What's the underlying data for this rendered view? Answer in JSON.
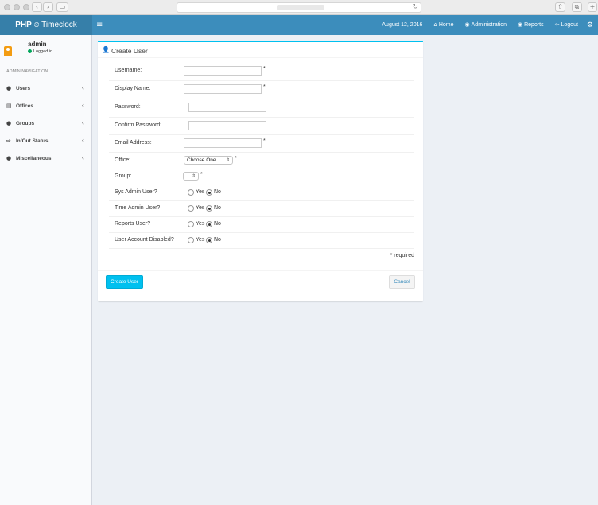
{
  "browser": {
    "back_glyph": "‹",
    "forward_glyph": "›",
    "sidebar_glyph": "▭",
    "reload_glyph": "↻",
    "share_glyph": "⇧",
    "tabs_glyph": "⧉",
    "newtab_glyph": "+"
  },
  "header": {
    "logo_bold": "PHP",
    "logo_icon": "⏲",
    "logo_text": "Timeclock",
    "menu_glyph": "≡",
    "date": "August 12, 2016",
    "nav": [
      {
        "icon": "⌂",
        "label": "Home"
      },
      {
        "icon": "◉",
        "label": "Administration"
      },
      {
        "icon": "◉",
        "label": "Reports"
      },
      {
        "icon": "⇦",
        "label": "Logout"
      }
    ],
    "settings_glyph": "⚙"
  },
  "sidebar": {
    "user_name": "admin",
    "status": "Logged in",
    "section": "ADMIN NAVIGATION",
    "items": [
      {
        "icon": "●",
        "label": "Users"
      },
      {
        "icon": "▤",
        "label": "Offices"
      },
      {
        "icon": "●",
        "label": "Groups"
      },
      {
        "icon": "⇨",
        "label": "In/Out Status"
      },
      {
        "icon": "●",
        "label": "Miscellaneous"
      }
    ],
    "chevron": "‹"
  },
  "form": {
    "title": "Create User",
    "title_icon": "👤",
    "fields": {
      "username": {
        "label": "Username:",
        "value": ""
      },
      "display_name": {
        "label": "Display Name:",
        "value": ""
      },
      "password": {
        "label": "Password:",
        "value": ""
      },
      "confirm_password": {
        "label": "Confirm Password:",
        "value": ""
      },
      "email": {
        "label": "Email Address:",
        "value": ""
      },
      "office": {
        "label": "Office:",
        "selected": "Choose One"
      },
      "group": {
        "label": "Group:",
        "selected": ""
      }
    },
    "asterisk": "*",
    "select_arrow": "⇕",
    "radios": [
      {
        "label": "Sys Admin User?",
        "yes": "Yes",
        "no": "No",
        "selected": "no"
      },
      {
        "label": "Time Admin User?",
        "yes": "Yes",
        "no": "No",
        "selected": "no"
      },
      {
        "label": "Reports User?",
        "yes": "Yes",
        "no": "No",
        "selected": "no"
      },
      {
        "label": "User Account Disabled?",
        "yes": "Yes",
        "no": "No",
        "selected": "no"
      }
    ],
    "required_note": "* required",
    "create_button": "Create User",
    "cancel_button": "Cancel"
  },
  "colors": {
    "header": "#3c8dbc",
    "logo_bg": "#367fa9",
    "accent": "#00c0ef",
    "avatar": "#f39c12",
    "status_dot": "#00a65a"
  }
}
